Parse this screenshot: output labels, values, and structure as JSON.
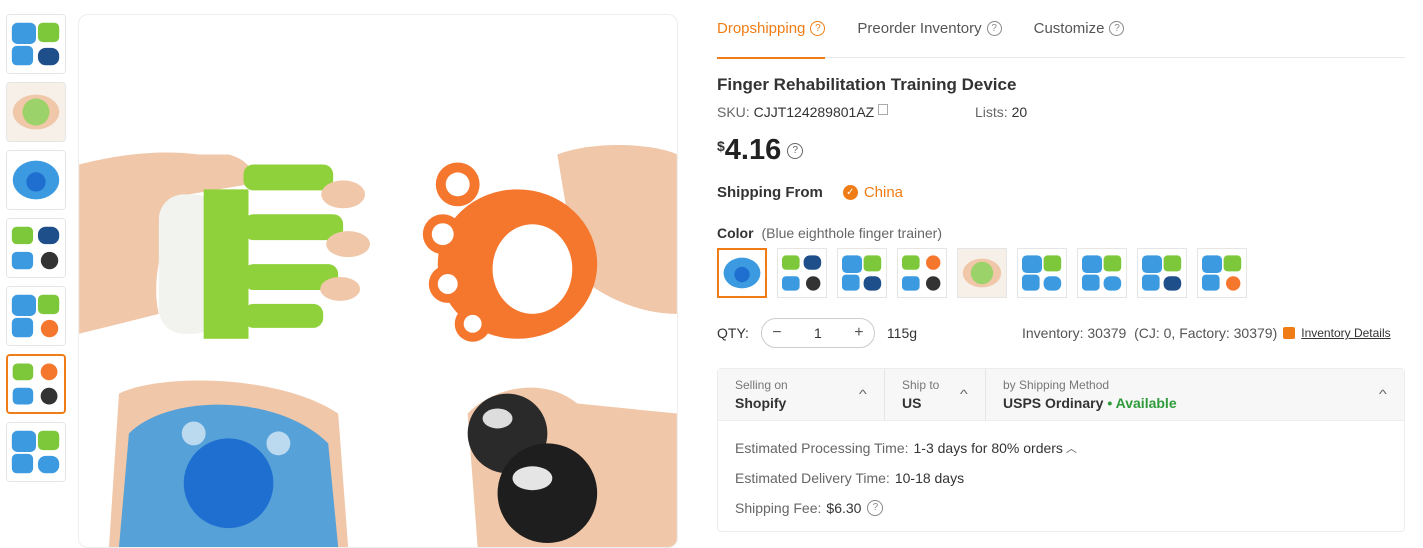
{
  "tabs": [
    {
      "label": "Dropshipping",
      "active": true
    },
    {
      "label": "Preorder Inventory",
      "active": false
    },
    {
      "label": "Customize",
      "active": false
    }
  ],
  "product": {
    "title": "Finger Rehabilitation Training Device",
    "sku_label": "SKU:",
    "sku": "CJJT124289801AZ",
    "lists_label": "Lists:",
    "lists": "20",
    "currency": "$",
    "price": "4.16"
  },
  "shipping_from": {
    "label": "Shipping From",
    "country": "China"
  },
  "color": {
    "label": "Color",
    "selected": "(Blue eighthole finger trainer)",
    "swatch_count": 9,
    "active_index": 0
  },
  "thumbnails": {
    "count": 7,
    "active_index": 5
  },
  "qty": {
    "label": "QTY:",
    "value": "1",
    "weight": "115g"
  },
  "inventory": {
    "text": "Inventory: 30379",
    "breakdown": "(CJ: 0, Factory: 30379)",
    "link": "Inventory Details"
  },
  "shipping": {
    "selling_on_label": "Selling on",
    "selling_on": "Shopify",
    "ship_to_label": "Ship to",
    "ship_to": "US",
    "method_label": "by Shipping Method",
    "method": "USPS Ordinary",
    "status": "• Available",
    "processing_label": "Estimated Processing Time:",
    "processing": "1-3 days for 80% orders",
    "delivery_label": "Estimated Delivery Time:",
    "delivery": "10-18 days",
    "fee_label": "Shipping Fee:",
    "fee": "$6.30"
  },
  "colors": {
    "accent": "#f07c15",
    "available": "#2e9b3a"
  }
}
